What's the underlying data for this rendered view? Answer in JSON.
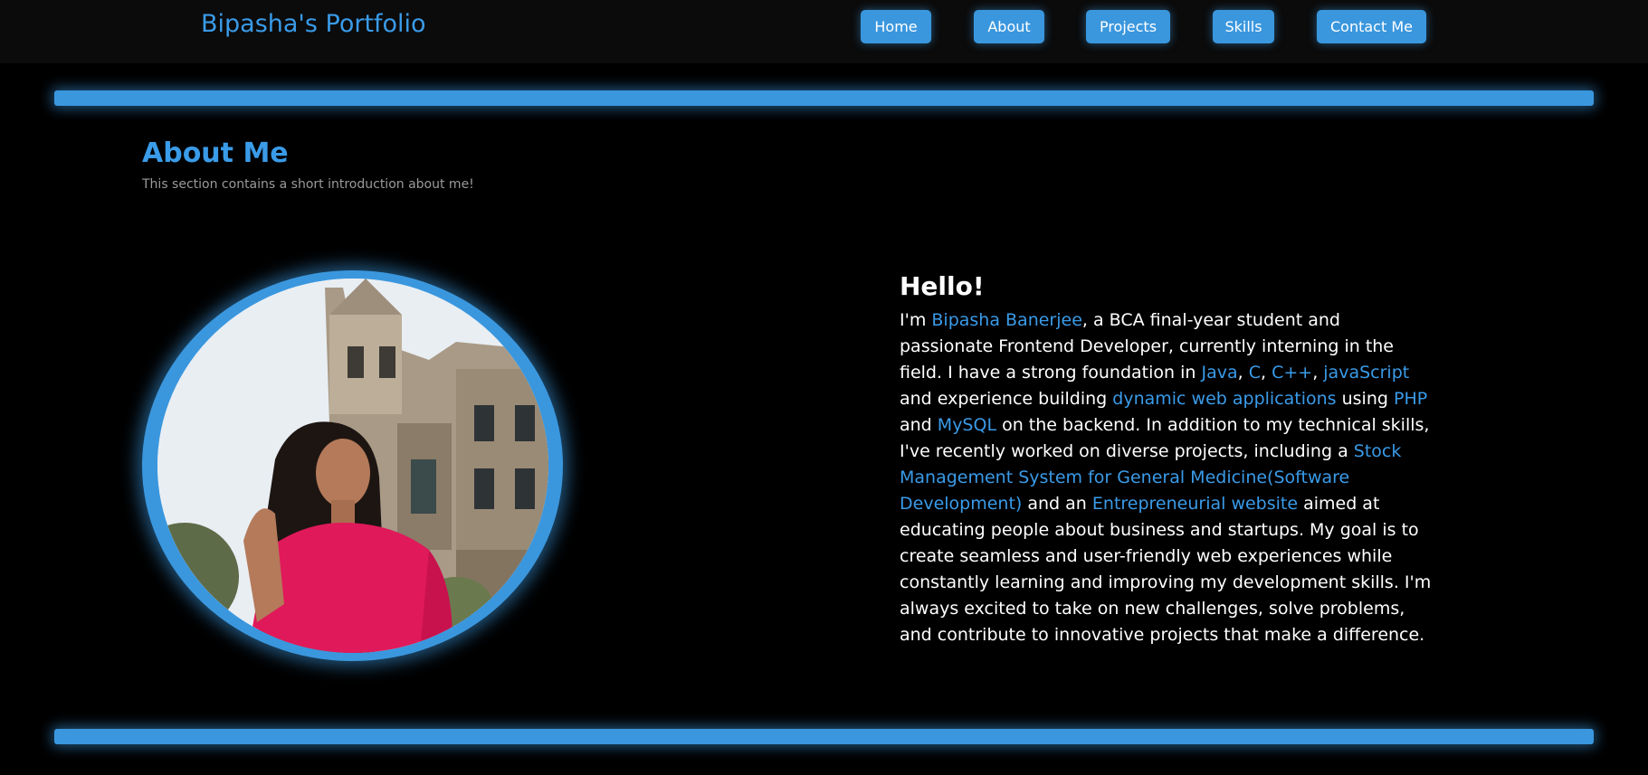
{
  "header": {
    "brand": "Bipasha's Portfolio",
    "nav": [
      "Home",
      "About",
      "Projects",
      "Skills",
      "Contact Me"
    ]
  },
  "section": {
    "title": "About Me",
    "subtitle": "This section contains a short introduction about me!"
  },
  "about": {
    "greeting": "Hello!",
    "p1": "I'm ",
    "name": "Bipasha Banerjee",
    "p2": ", a BCA final-year student and passionate Frontend Developer, currently interning in the field. I have a strong foundation in ",
    "skill_java": "Java",
    "comma1": ", ",
    "skill_c": "C",
    "comma2": ", ",
    "skill_cpp": "C++",
    "comma3": ", ",
    "skill_js": "javaScript",
    "p3": " and experience building ",
    "dyn_web": "dynamic web applications",
    "p4": " using ",
    "php": "PHP",
    "p5": " and ",
    "mysql": "MySQL",
    "p6": " on the backend. In addition to my technical skills, I've recently worked on diverse projects, including a ",
    "project1": "Stock Management System for General Medicine(Software Development)",
    "p7": " and an ",
    "project2": "Entrepreneurial website",
    "p8": " aimed at educating people about business and startups. My goal is to create seamless and user-friendly web experiences while constantly learning and improving my development skills. I'm always excited to take on new challenges, solve problems, and contribute to innovative projects that make a difference."
  },
  "colors": {
    "accent": "#3a97de",
    "background": "#000000",
    "navbar": "#0b0b0b"
  }
}
